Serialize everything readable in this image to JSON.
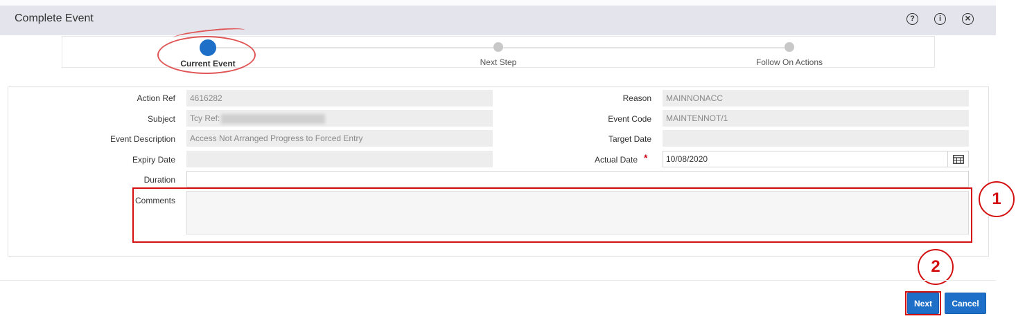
{
  "header": {
    "title": "Complete Event",
    "icons": [
      "help-icon",
      "info-icon",
      "close-icon"
    ],
    "icon_glyphs": {
      "help": "?",
      "info": "i",
      "close": "×"
    }
  },
  "train": {
    "steps": [
      {
        "label": "Current Event",
        "active": true
      },
      {
        "label": "Next Step",
        "active": false
      },
      {
        "label": "Follow On Actions",
        "active": false
      }
    ]
  },
  "form": {
    "action_ref": {
      "label": "Action Ref",
      "value": "4616282"
    },
    "subject": {
      "label": "Subject",
      "value": "Tcy Ref:"
    },
    "event_description": {
      "label": "Event Description",
      "value": "Access Not Arranged Progress to Forced Entry"
    },
    "expiry_date": {
      "label": "Expiry Date",
      "value": ""
    },
    "duration": {
      "label": "Duration",
      "value": ""
    },
    "comments": {
      "label": "Comments",
      "value": ""
    },
    "reason": {
      "label": "Reason",
      "value": "MAINNONACC"
    },
    "event_code": {
      "label": "Event Code",
      "value": "MAINTENNOT/1"
    },
    "target_date": {
      "label": "Target Date",
      "value": ""
    },
    "actual_date": {
      "label": "Actual Date",
      "value": "10/08/2020",
      "required_marker": "*"
    }
  },
  "annotations": {
    "one": "1",
    "two": "2"
  },
  "buttons": {
    "next": "Next",
    "cancel": "Cancel"
  },
  "colors": {
    "accent": "#1d6fc8",
    "annotation": "#d40f0f",
    "header_bg": "#e4e4ec"
  }
}
